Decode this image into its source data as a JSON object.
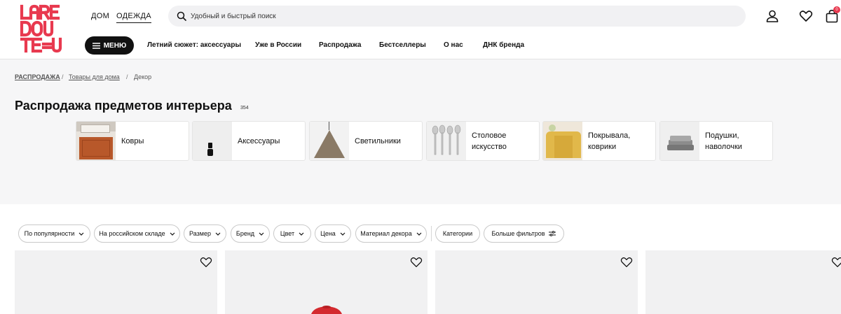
{
  "brand": {
    "logo_text": "LAREDOUTE",
    "logo_color": "#e8394f"
  },
  "universes": [
    {
      "label": "ДОМ",
      "active": false
    },
    {
      "label": "ОДЕЖДА",
      "active": true
    }
  ],
  "search": {
    "placeholder": "Удобный и быстрый поиск",
    "icon": "search-icon"
  },
  "header_icons": [
    "user-icon",
    "heart-icon",
    "bag-icon"
  ],
  "cart_count": "0",
  "menu": {
    "label": "МЕНЮ",
    "icon": "hamburger-icon"
  },
  "nav": [
    "Летний сюжет: аксессуары",
    "Уже в России",
    "Распродажа",
    "Бестселлеры",
    "О нас",
    "ДНК бренда"
  ],
  "breadcrumb": [
    {
      "label": "РАСПРОДАЖА",
      "link": true
    },
    {
      "label": "Товары для дома",
      "link": true
    },
    {
      "label": "Декор",
      "link": false
    }
  ],
  "breadcrumb_sep": "/",
  "page": {
    "title": "Распродажа предметов интерьера",
    "count": "354"
  },
  "categories": [
    {
      "line1": "Ковры",
      "line2": ""
    },
    {
      "line1": "Аксессуары",
      "line2": ""
    },
    {
      "line1": "Светильники",
      "line2": ""
    },
    {
      "line1": "Столовое",
      "line2": "искусство"
    },
    {
      "line1": "Покрывала,",
      "line2": "коврики"
    },
    {
      "line1": "Подушки,",
      "line2": "наволочки"
    }
  ],
  "filters": [
    "По популярности",
    "На российском складе",
    "Размер",
    "Бренд",
    "Цвет",
    "Цена",
    "Материал декора",
    "Категории",
    "Больше фильтров"
  ],
  "colors": {
    "accent": "#e8394f",
    "dark": "#111111"
  }
}
